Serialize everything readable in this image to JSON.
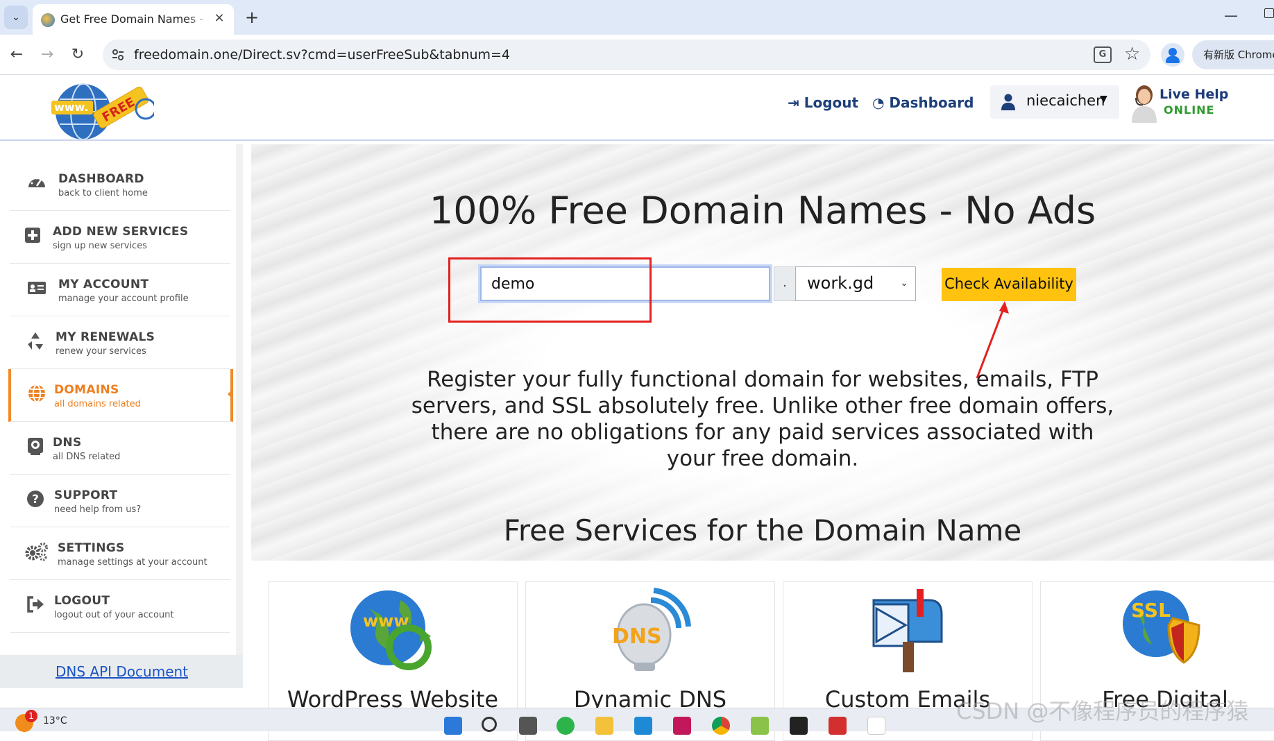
{
  "browser": {
    "tab_title": "Get Free Domain Names - Re",
    "new_tab": "+",
    "tab_close": "×",
    "url": "freedomain.one/Direct.sv?cmd=userFreeSub&tabnum=4",
    "update_chip": "有新版 Chrome",
    "nav": {
      "back": "←",
      "forward": "→",
      "reload": "↻"
    },
    "minimize": "—",
    "star": "☆",
    "translate": "G"
  },
  "header": {
    "logo_text": "FREE",
    "logout": "Logout",
    "dashboard": "Dashboard",
    "username": "niecaichen",
    "livehelp_title": "Live Help",
    "livehelp_status": "ONLINE"
  },
  "sidebar": {
    "items": [
      {
        "label": "DASHBOARD",
        "sub": "back to client home",
        "icon": "gauge-icon"
      },
      {
        "label": "ADD NEW SERVICES",
        "sub": "sign up new services",
        "icon": "plus-square-icon"
      },
      {
        "label": "MY ACCOUNT",
        "sub": "manage your account profile",
        "icon": "id-card-icon"
      },
      {
        "label": "MY RENEWALS",
        "sub": "renew your services",
        "icon": "recycle-icon"
      },
      {
        "label": "DOMAINS",
        "sub": "all domains related",
        "icon": "globe-icon",
        "active": true
      },
      {
        "label": "DNS",
        "sub": "all DNS related",
        "icon": "dns-icon"
      },
      {
        "label": "SUPPORT",
        "sub": "need help from us?",
        "icon": "question-icon"
      },
      {
        "label": "SETTINGS",
        "sub": "manage settings at your account",
        "icon": "gears-icon"
      },
      {
        "label": "LOGOUT",
        "sub": "logout out of your account",
        "icon": "logout-icon"
      }
    ],
    "dns_api": "DNS API Document",
    "active_color": "#ee7f1f"
  },
  "hero": {
    "title": "100% Free Domain Names - No Ads",
    "search_value": "demo",
    "dot": ".",
    "tld": "work.gd",
    "check_button": "Check Availability",
    "description": "Register your fully functional domain for websites, emails, FTP servers, and SSL absolutely free. Unlike other free domain offers, there are no obligations for any paid services associated with your free domain."
  },
  "services": {
    "title": "Free Services for the Domain Name",
    "cards": [
      "WordPress Website",
      "Dynamic DNS",
      "Custom Emails",
      "Free Digital"
    ]
  },
  "taskbar": {
    "temperature": "13°C",
    "badge": "1"
  },
  "watermark": "CSDN @不像程序员的程序猿",
  "colors": {
    "accent_button": "#ffc20e",
    "highlight_box": "#e42020",
    "link": "#1d3f7a"
  }
}
